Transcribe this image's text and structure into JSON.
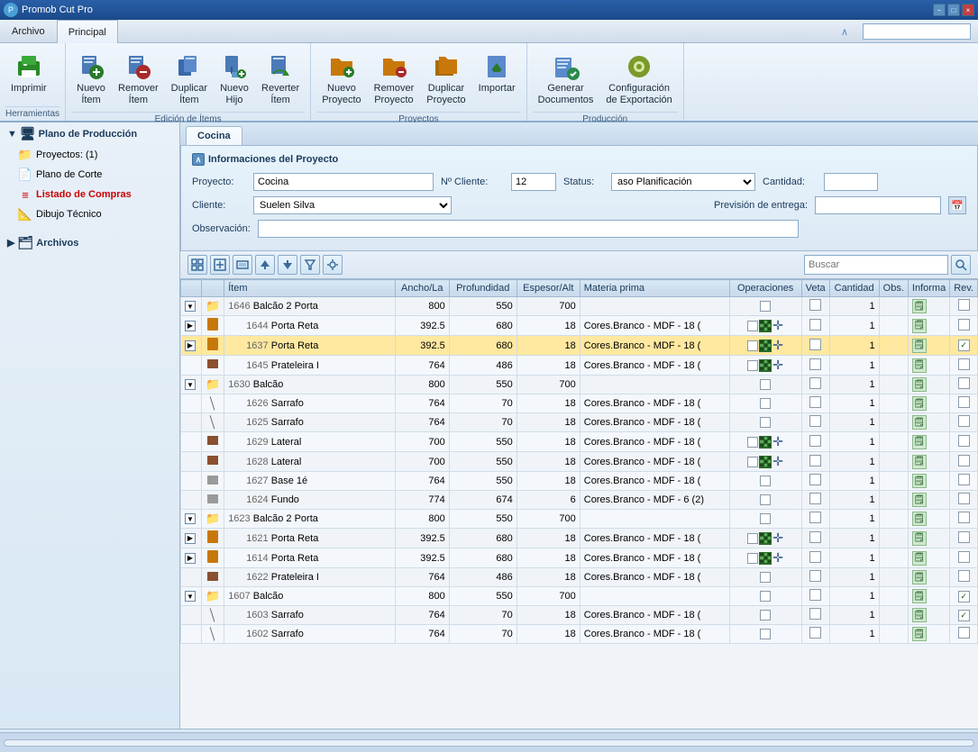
{
  "title_bar": {
    "app_name": "Promob Cut Pro",
    "min_label": "−",
    "max_label": "□",
    "close_label": "×"
  },
  "menu": {
    "archivo_label": "Archivo",
    "principal_label": "Principal"
  },
  "ribbon": {
    "groups": [
      {
        "name": "herramientas",
        "label": "Herramientas",
        "buttons": [
          {
            "id": "imprimir",
            "label": "Imprimir",
            "icon": "🖨"
          }
        ]
      },
      {
        "name": "edicion_items",
        "label": "Edición de Ítems",
        "buttons": [
          {
            "id": "nuevo_item",
            "label": "Nuevo\nÍtem",
            "icon": "📦"
          },
          {
            "id": "remover_item",
            "label": "Remover\nÍtem",
            "icon": "📦"
          },
          {
            "id": "duplicar_item",
            "label": "Duplicar\nÍtem",
            "icon": "📦"
          },
          {
            "id": "nuevo_hijo",
            "label": "Nuevo\nHijo",
            "icon": "📦"
          },
          {
            "id": "reverter_item",
            "label": "Reverter\nÍtem",
            "icon": "📦"
          }
        ]
      },
      {
        "name": "proyectos",
        "label": "Proyectos",
        "buttons": [
          {
            "id": "nuevo_proyecto",
            "label": "Nuevo\nProyecto",
            "icon": "📁"
          },
          {
            "id": "remover_proyecto",
            "label": "Remover\nProyecto",
            "icon": "📁"
          },
          {
            "id": "duplicar_proyecto",
            "label": "Duplicar\nProyecto",
            "icon": "📁"
          },
          {
            "id": "importar",
            "label": "Importar",
            "icon": "📥"
          }
        ]
      },
      {
        "name": "produccion",
        "label": "Producción",
        "buttons": [
          {
            "id": "generar_doc",
            "label": "Generar\nDocumentos",
            "icon": "📋"
          },
          {
            "id": "config_export",
            "label": "Configuración\nde Exportación",
            "icon": "⚙"
          }
        ]
      }
    ]
  },
  "sidebar": {
    "title": "Promob Cut Pro",
    "items": [
      {
        "id": "plano_produccion",
        "label": "Plano de Producción",
        "type": "section",
        "indent": 0
      },
      {
        "id": "proyectos",
        "label": "Proyectos: (1)",
        "type": "item",
        "indent": 1
      },
      {
        "id": "plano_corte",
        "label": "Plano de Corte",
        "type": "item",
        "indent": 1
      },
      {
        "id": "listado_compras",
        "label": "Listado de Compras",
        "type": "item",
        "indent": 1,
        "active": true
      },
      {
        "id": "dibujo_tecnico",
        "label": "Dibujo Técnico",
        "type": "item",
        "indent": 1
      },
      {
        "id": "archivos",
        "label": "Archivos",
        "type": "section",
        "indent": 0
      }
    ],
    "archivos_label": "Archivos"
  },
  "tab": {
    "label": "Cocina"
  },
  "project_info": {
    "title": "Informaciones del Proyecto",
    "proyecto_label": "Proyecto:",
    "proyecto_value": "Cocina",
    "no_cliente_label": "Nº Cliente:",
    "no_cliente_value": "12",
    "status_label": "Status:",
    "status_value": "aso Planificación",
    "cantidad_label": "Cantidad:",
    "cantidad_value": "",
    "cliente_label": "Cliente:",
    "cliente_value": "Suelen Silva",
    "prevision_label": "Previsión de entrega:",
    "observacion_label": "Observación:",
    "observacion_value": ""
  },
  "toolbar": {
    "search_placeholder": "Buscar"
  },
  "table": {
    "columns": [
      {
        "id": "expand",
        "label": ""
      },
      {
        "id": "item",
        "label": "Ítem"
      },
      {
        "id": "ancho",
        "label": "Ancho/La"
      },
      {
        "id": "profundidad",
        "label": "Profundidad"
      },
      {
        "id": "espesor",
        "label": "Espesor/Alt"
      },
      {
        "id": "materia",
        "label": "Materia prima"
      },
      {
        "id": "operaciones",
        "label": "Operaciones"
      },
      {
        "id": "veta",
        "label": "Veta"
      },
      {
        "id": "cantidad",
        "label": "Cantidad"
      },
      {
        "id": "obs",
        "label": "Obs."
      },
      {
        "id": "informa",
        "label": "Informa"
      },
      {
        "id": "rev",
        "label": "Rev."
      }
    ],
    "rows": [
      {
        "id": "r1",
        "level": 1,
        "expand": "▼",
        "code": "1646",
        "name": "Balcão 2 Porta",
        "ancho": "800",
        "prof": "550",
        "esp": "700",
        "materia": "",
        "ops": "none",
        "veta": false,
        "qty": "1",
        "obs": "",
        "info": true,
        "rev": false,
        "type": "folder"
      },
      {
        "id": "r2",
        "level": 2,
        "expand": "▶",
        "code": "1644",
        "name": "Porta Reta",
        "ancho": "392.5",
        "prof": "680",
        "esp": "18",
        "materia": "Cores.Branco - MDF - 18 (",
        "ops": "grid",
        "veta": false,
        "qty": "1",
        "obs": "",
        "info": true,
        "rev": false,
        "type": "page"
      },
      {
        "id": "r3",
        "level": 2,
        "expand": "▶",
        "code": "1637",
        "name": "Porta Reta",
        "ancho": "392.5",
        "prof": "680",
        "esp": "18",
        "materia": "Cores.Branco - MDF - 18 (",
        "ops": "grid",
        "veta": false,
        "qty": "1",
        "obs": "",
        "info": true,
        "rev": true,
        "type": "page",
        "highlighted": true
      },
      {
        "id": "r4",
        "level": 2,
        "expand": "",
        "code": "1645",
        "name": "Prateleira I",
        "ancho": "764",
        "prof": "486",
        "esp": "18",
        "materia": "Cores.Branco - MDF - 18 (",
        "ops": "grid",
        "veta": false,
        "qty": "1",
        "obs": "",
        "info": true,
        "rev": false,
        "type": "piece"
      },
      {
        "id": "r5",
        "level": 1,
        "expand": "▼",
        "code": "1630",
        "name": "Balcão",
        "ancho": "800",
        "prof": "550",
        "esp": "700",
        "materia": "",
        "ops": "none",
        "veta": false,
        "qty": "1",
        "obs": "",
        "info": true,
        "rev": false,
        "type": "folder"
      },
      {
        "id": "r6",
        "level": 2,
        "expand": "",
        "code": "1626",
        "name": "Sarrafo",
        "ancho": "764",
        "prof": "70",
        "esp": "18",
        "materia": "Cores.Branco - MDF - 18 (",
        "ops": "none",
        "veta": false,
        "qty": "1",
        "obs": "",
        "info": true,
        "rev": false,
        "type": "slash"
      },
      {
        "id": "r7",
        "level": 2,
        "expand": "",
        "code": "1625",
        "name": "Sarrafo",
        "ancho": "764",
        "prof": "70",
        "esp": "18",
        "materia": "Cores.Branco - MDF - 18 (",
        "ops": "none",
        "veta": false,
        "qty": "1",
        "obs": "",
        "info": true,
        "rev": false,
        "type": "slash"
      },
      {
        "id": "r8",
        "level": 2,
        "expand": "",
        "code": "1629",
        "name": "Lateral",
        "ancho": "700",
        "prof": "550",
        "esp": "18",
        "materia": "Cores.Branco - MDF - 18 (",
        "ops": "grid",
        "veta": false,
        "qty": "1",
        "obs": "",
        "info": true,
        "rev": false,
        "type": "piece"
      },
      {
        "id": "r9",
        "level": 2,
        "expand": "",
        "code": "1628",
        "name": "Lateral",
        "ancho": "700",
        "prof": "550",
        "esp": "18",
        "materia": "Cores.Branco - MDF - 18 (",
        "ops": "grid",
        "veta": false,
        "qty": "1",
        "obs": "",
        "info": true,
        "rev": false,
        "type": "piece"
      },
      {
        "id": "r10",
        "level": 2,
        "expand": "",
        "code": "1627",
        "name": "Base 1é",
        "ancho": "764",
        "prof": "550",
        "esp": "18",
        "materia": "Cores.Branco - MDF - 18 (",
        "ops": "none",
        "veta": false,
        "qty": "1",
        "obs": "",
        "info": true,
        "rev": false,
        "type": "piece_gray"
      },
      {
        "id": "r11",
        "level": 2,
        "expand": "",
        "code": "1624",
        "name": "Fundo",
        "ancho": "774",
        "prof": "674",
        "esp": "6",
        "materia": "Cores.Branco - MDF - 6 (2)",
        "ops": "none",
        "veta": false,
        "qty": "1",
        "obs": "",
        "info": true,
        "rev": false,
        "type": "piece_gray"
      },
      {
        "id": "r12",
        "level": 1,
        "expand": "▼",
        "code": "1623",
        "name": "Balcão 2 Porta",
        "ancho": "800",
        "prof": "550",
        "esp": "700",
        "materia": "",
        "ops": "none",
        "veta": false,
        "qty": "1",
        "obs": "",
        "info": true,
        "rev": false,
        "type": "folder"
      },
      {
        "id": "r13",
        "level": 2,
        "expand": "▶",
        "code": "1621",
        "name": "Porta Reta",
        "ancho": "392.5",
        "prof": "680",
        "esp": "18",
        "materia": "Cores.Branco - MDF - 18 (",
        "ops": "grid",
        "veta": false,
        "qty": "1",
        "obs": "",
        "info": true,
        "rev": false,
        "type": "page"
      },
      {
        "id": "r14",
        "level": 2,
        "expand": "▶",
        "code": "1614",
        "name": "Porta Reta",
        "ancho": "392.5",
        "prof": "680",
        "esp": "18",
        "materia": "Cores.Branco - MDF - 18 (",
        "ops": "grid",
        "veta": false,
        "qty": "1",
        "obs": "",
        "info": true,
        "rev": false,
        "type": "page"
      },
      {
        "id": "r15",
        "level": 2,
        "expand": "",
        "code": "1622",
        "name": "Prateleira I",
        "ancho": "764",
        "prof": "486",
        "esp": "18",
        "materia": "Cores.Branco - MDF - 18 (",
        "ops": "none",
        "veta": false,
        "qty": "1",
        "obs": "",
        "info": true,
        "rev": false,
        "type": "piece"
      },
      {
        "id": "r16",
        "level": 1,
        "expand": "▼",
        "code": "1607",
        "name": "Balcão",
        "ancho": "800",
        "prof": "550",
        "esp": "700",
        "materia": "",
        "ops": "none",
        "veta": false,
        "qty": "1",
        "obs": "",
        "info": true,
        "rev": true,
        "type": "folder"
      },
      {
        "id": "r17",
        "level": 2,
        "expand": "",
        "code": "1603",
        "name": "Sarrafo",
        "ancho": "764",
        "prof": "70",
        "esp": "18",
        "materia": "Cores.Branco - MDF - 18 (",
        "ops": "none",
        "veta": false,
        "qty": "1",
        "obs": "",
        "info": true,
        "rev": true,
        "type": "slash"
      },
      {
        "id": "r18",
        "level": 2,
        "expand": "",
        "code": "1602",
        "name": "Sarrafo",
        "ancho": "764",
        "prof": "70",
        "esp": "18",
        "materia": "Cores.Branco - MDF - 18 (",
        "ops": "none",
        "veta": false,
        "qty": "1",
        "obs": "",
        "info": true,
        "rev": false,
        "type": "slash"
      }
    ]
  },
  "status_bar": {
    "scroll_left": "◀",
    "scroll_right": "▶"
  }
}
